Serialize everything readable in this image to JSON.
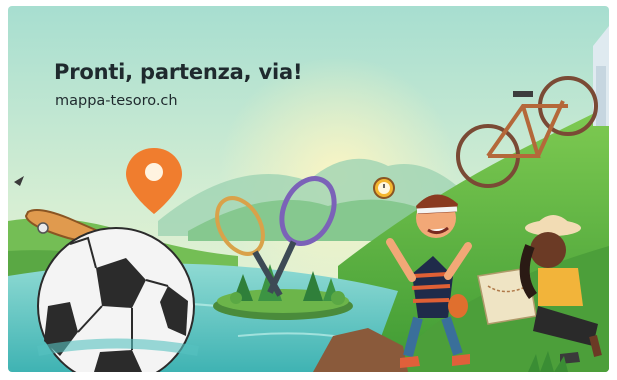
{
  "banner": {
    "headline": "Pronti, partenza, via!",
    "url": "mappa-tesoro.ch"
  },
  "illustration": {
    "elements": [
      "location-pin-icon",
      "skateboard",
      "tennis-rackets",
      "soccer-ball",
      "island",
      "stopwatch-icon",
      "treasure-map",
      "bicycle",
      "boy-explorer",
      "girl-explorer"
    ]
  },
  "colors": {
    "sky_top": "#a9dfcf",
    "sky_bottom": "#e9f3cf",
    "grass": "#6cc03d",
    "water": "#62c8c2",
    "pin": "#f07d2e",
    "text": "#1f2a2e"
  }
}
